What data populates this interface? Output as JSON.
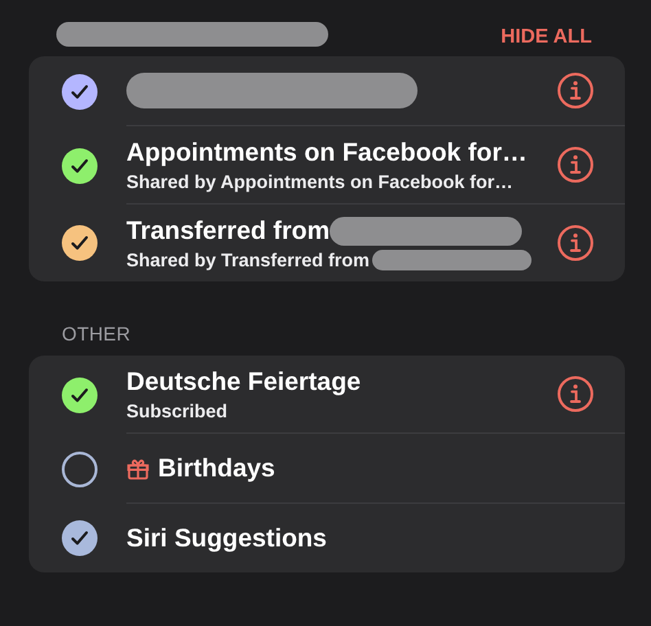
{
  "header": {
    "title_redacted": true,
    "action": "HIDE ALL"
  },
  "sections": [
    {
      "calendars": [
        {
          "title_redacted": true,
          "checked": true,
          "color": "#b4b6ff",
          "info": true
        },
        {
          "title": "Appointments on Facebook for…",
          "subtitle": "Shared by Appointments on Facebook for…",
          "checked": true,
          "color": "#8eef6c",
          "info": true
        },
        {
          "title": "Transferred from",
          "title_redacted": true,
          "subtitle": "Shared by Transferred from",
          "subtitle_redacted": true,
          "checked": true,
          "color": "#f6c27f",
          "info": true
        }
      ]
    },
    {
      "title": "OTHER",
      "calendars": [
        {
          "title": "Deutsche Feiertage",
          "subtitle": "Subscribed",
          "checked": true,
          "color": "#8eef6c",
          "info": true
        },
        {
          "title": "Birthdays",
          "kind": "birthdays",
          "checked": false,
          "color": "#a9b7d6",
          "info": false
        },
        {
          "title": "Siri Suggestions",
          "checked": true,
          "color": "#a9b9dc",
          "info": false
        }
      ]
    }
  ]
}
